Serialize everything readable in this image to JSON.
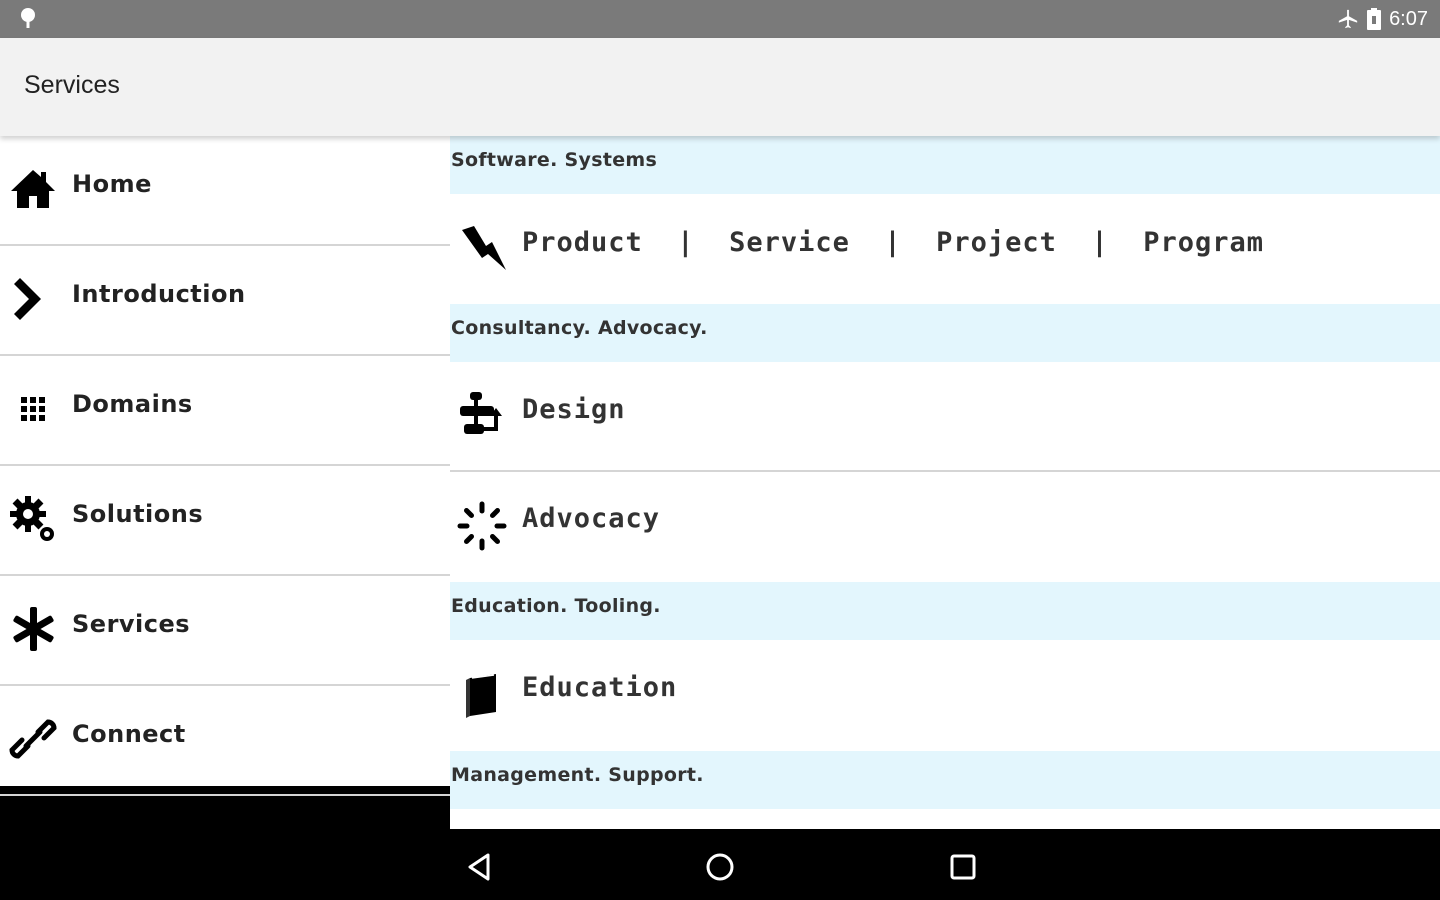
{
  "status_bar": {
    "time": "6:07",
    "icons": [
      "notification-pin-icon",
      "airplane-mode-icon",
      "battery-icon"
    ]
  },
  "app_bar": {
    "title": "Services"
  },
  "drawer": {
    "items": [
      {
        "label": "Home",
        "icon": "home-icon"
      },
      {
        "label": "Introduction",
        "icon": "chevron-right-icon"
      },
      {
        "label": "Domains",
        "icon": "grid-icon"
      },
      {
        "label": "Solutions",
        "icon": "gears-icon"
      },
      {
        "label": "Services",
        "icon": "asterisk-icon"
      },
      {
        "label": "Connect",
        "icon": "link-icon"
      }
    ]
  },
  "content": {
    "sections": [
      {
        "header": "Software. Systems",
        "items": [
          {
            "label": "Product  |  Service  |  Project  |  Program",
            "icon": "lightning-icon"
          }
        ]
      },
      {
        "header": "Consultancy. Advocacy.",
        "items": [
          {
            "label": "Design",
            "icon": "flowchart-icon"
          },
          {
            "label": "Advocacy",
            "icon": "spinner-icon"
          }
        ]
      },
      {
        "header": "Education. Tooling.",
        "items": [
          {
            "label": "Education",
            "icon": "book-icon"
          }
        ]
      },
      {
        "header": "Management. Support.",
        "items": []
      }
    ]
  },
  "nav_bar": {
    "buttons": [
      "back-icon",
      "home-circle-icon",
      "recents-icon"
    ]
  },
  "colors": {
    "status_bar": "#7a7a7a",
    "app_bar": "#f2f2f2",
    "section_bg": "#e3f6fd",
    "nav_bar": "#000000"
  }
}
